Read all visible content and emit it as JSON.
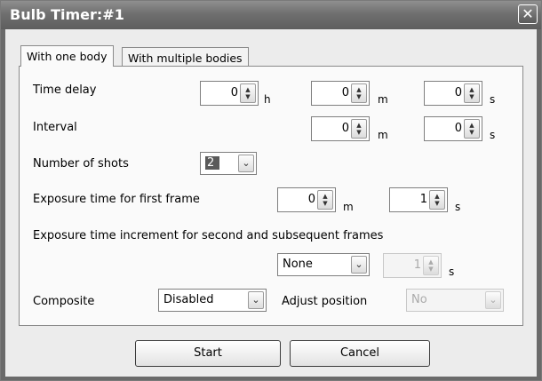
{
  "window": {
    "title": "Bulb Timer:#1",
    "close_glyph": "✕"
  },
  "tabs": [
    {
      "label": "With one body",
      "active": true
    },
    {
      "label": "With multiple bodies",
      "active": false
    }
  ],
  "rows": {
    "time_delay": {
      "label": "Time delay",
      "h": {
        "value": "0",
        "unit": "h"
      },
      "m": {
        "value": "0",
        "unit": "m"
      },
      "s": {
        "value": "0",
        "unit": "s"
      }
    },
    "interval": {
      "label": "Interval",
      "m": {
        "value": "0",
        "unit": "m"
      },
      "s": {
        "value": "0",
        "unit": "s"
      }
    },
    "number_of_shots": {
      "label": "Number of shots",
      "value": "2"
    },
    "exposure_first": {
      "label": "Exposure time for first frame",
      "m": {
        "value": "0",
        "unit": "m"
      },
      "s": {
        "value": "1",
        "unit": "s"
      }
    },
    "exposure_increment": {
      "label": "Exposure time increment for second and subsequent frames",
      "mode": "None",
      "value": "1",
      "unit": "s"
    },
    "composite": {
      "label": "Composite",
      "value": "Disabled"
    },
    "adjust_position": {
      "label": "Adjust position",
      "value": "No"
    }
  },
  "buttons": {
    "start": "Start",
    "cancel": "Cancel"
  },
  "icons": {
    "spin": "updown-arrows-icon",
    "dropdown": "chevron-down-icon"
  }
}
